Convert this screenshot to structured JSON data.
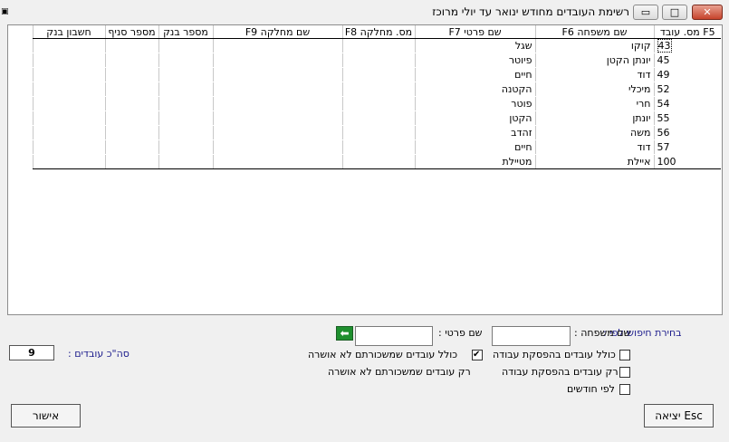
{
  "window": {
    "title": "רשימת העובדים מחודש ינואר עד יולי מרוכז",
    "app_icon": "app-icon",
    "controls": {
      "minimize": "minimize-icon",
      "maximize": "maximize-icon",
      "close": "close-icon"
    }
  },
  "table": {
    "columns": [
      "F5 מס. עובד",
      "שם משפחה F6",
      "שם פרטי F7",
      "מס. מחלקה F8",
      "שם מחלקה F9",
      "מספר בנק",
      "מספר סניף",
      "חשבון בנק"
    ],
    "rows": [
      [
        "43",
        "קוקו",
        "שגל",
        "",
        "",
        "",
        "",
        ""
      ],
      [
        "45",
        "יונתן הקטן",
        "פיוטר",
        "",
        "",
        "",
        "",
        ""
      ],
      [
        "49",
        "דוד",
        "חיים",
        "",
        "",
        "",
        "",
        ""
      ],
      [
        "52",
        "מיכלי",
        "הקטנה",
        "",
        "",
        "",
        "",
        ""
      ],
      [
        "54",
        "חרי",
        "פוטר",
        "",
        "",
        "",
        "",
        ""
      ],
      [
        "55",
        "יונתן",
        "הקטן",
        "",
        "",
        "",
        "",
        ""
      ],
      [
        "56",
        "משה",
        "זהדב",
        "",
        "",
        "",
        "",
        ""
      ],
      [
        "57",
        "דוד",
        "חיים",
        "",
        "",
        "",
        "",
        ""
      ],
      [
        "100",
        "איילת",
        "מטיילת",
        "",
        "",
        "",
        "",
        ""
      ]
    ]
  },
  "search": {
    "label": "בחירת חיפוש לפי :",
    "last_name_label": "שם משפחה :",
    "last_name_value": "",
    "first_name_label": "שם פרטי :",
    "first_name_value": "",
    "go_icon": "arrow-left-icon"
  },
  "options": {
    "include_stopped": {
      "label": "כולל עובדים בהפסקת עבודה",
      "checked": false
    },
    "include_unapproved": {
      "label": "כולל עובדים שמשכורתם לא אושרה",
      "checked": true
    },
    "only_stopped": {
      "label": "רק עובדים בהפסקת עבודה",
      "checked": false
    },
    "only_unapproved": {
      "label": "רק עובדים שמשכורתם לא אושרה",
      "checked": false
    },
    "by_months": {
      "label": "לפי חודשים",
      "checked": false
    }
  },
  "summary": {
    "total_label": "סה\"כ עובדים :",
    "total_value": "9"
  },
  "buttons": {
    "exit": "יציאה Esc",
    "confirm": "אישור"
  }
}
